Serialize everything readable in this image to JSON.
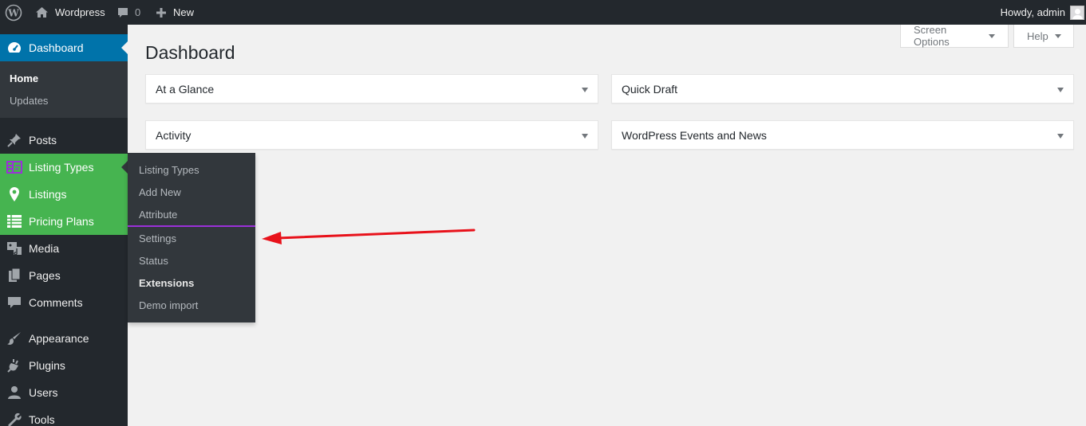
{
  "admin_bar": {
    "site_name": "Wordpress",
    "comments_count": "0",
    "new_label": "New",
    "greeting": "Howdy, admin"
  },
  "sidebar": {
    "dashboard": "Dashboard",
    "dashboard_sub": [
      "Home",
      "Updates"
    ],
    "items": [
      {
        "label": "Posts",
        "icon": "pin-icon"
      },
      {
        "label": "Listing Types",
        "icon": "listing-types-icon"
      },
      {
        "label": "Listings",
        "icon": "location-pin-icon"
      },
      {
        "label": "Pricing Plans",
        "icon": "pricing-table-icon"
      },
      {
        "label": "Media",
        "icon": "media-icon"
      },
      {
        "label": "Pages",
        "icon": "pages-icon"
      },
      {
        "label": "Comments",
        "icon": "comment-icon"
      },
      {
        "label": "Appearance",
        "icon": "paintbrush-icon"
      },
      {
        "label": "Plugins",
        "icon": "plugin-icon"
      },
      {
        "label": "Users",
        "icon": "user-icon"
      },
      {
        "label": "Tools",
        "icon": "wrench-icon"
      }
    ]
  },
  "flyout": {
    "items": [
      "Listing Types",
      "Add New",
      "Attribute",
      "Settings",
      "Status",
      "Extensions",
      "Demo import"
    ]
  },
  "header": {
    "screen_options": "Screen Options",
    "help": "Help",
    "title": "Dashboard"
  },
  "widgets": [
    "At a Glance",
    "Quick Draft",
    "Activity",
    "WordPress Events and News"
  ],
  "colors": {
    "admin_bar": "#23282d",
    "current_menu": "#0073aa",
    "highlight_green": "#46b450",
    "flyout_divider": "#9b30d9",
    "annotation_arrow": "#e8121b"
  }
}
